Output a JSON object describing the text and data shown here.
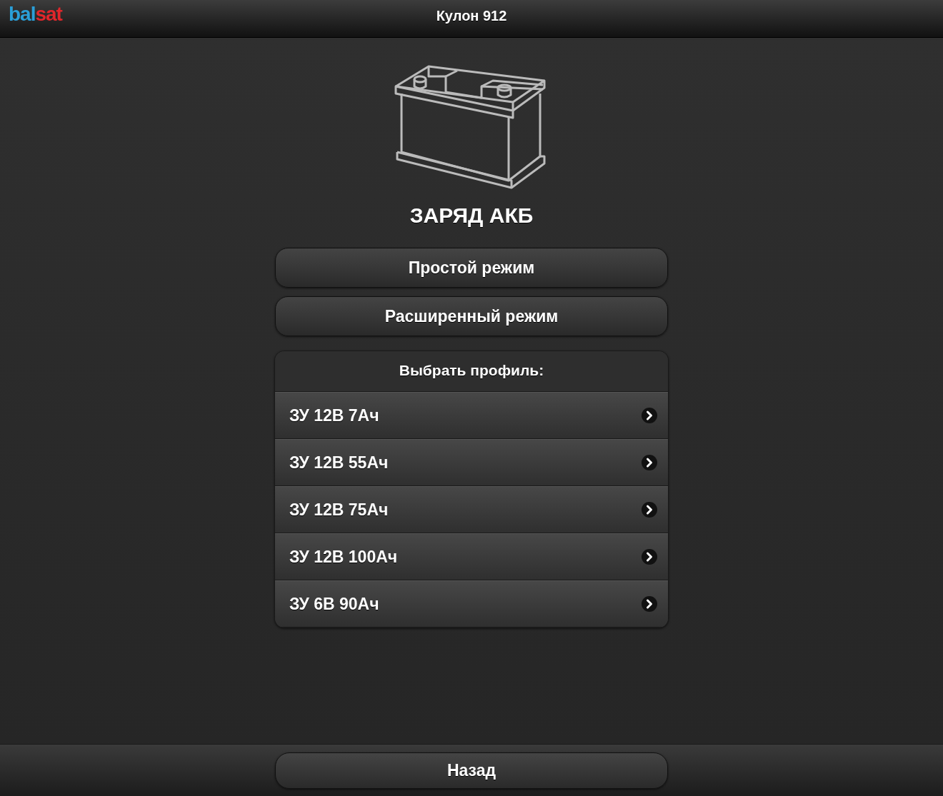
{
  "header": {
    "logo": [
      {
        "text": "bal",
        "color": "#2a9fd8"
      },
      {
        "text": "sat",
        "color": "#e0262b"
      }
    ],
    "title": "Кулон 912"
  },
  "heading": "ЗАРЯД АКБ",
  "mode_buttons": [
    "Простой режим",
    "Расширенный режим"
  ],
  "profiles": {
    "title": "Выбрать профиль:",
    "items": [
      {
        "label": "ЗУ 12В 7Ач"
      },
      {
        "label": "ЗУ 12В 55Ач"
      },
      {
        "label": "ЗУ 12В 75Ач"
      },
      {
        "label": "ЗУ 12В 100Ач"
      },
      {
        "label": "ЗУ 6В 90Ач"
      }
    ]
  },
  "footer": {
    "back_button": "Назад"
  }
}
